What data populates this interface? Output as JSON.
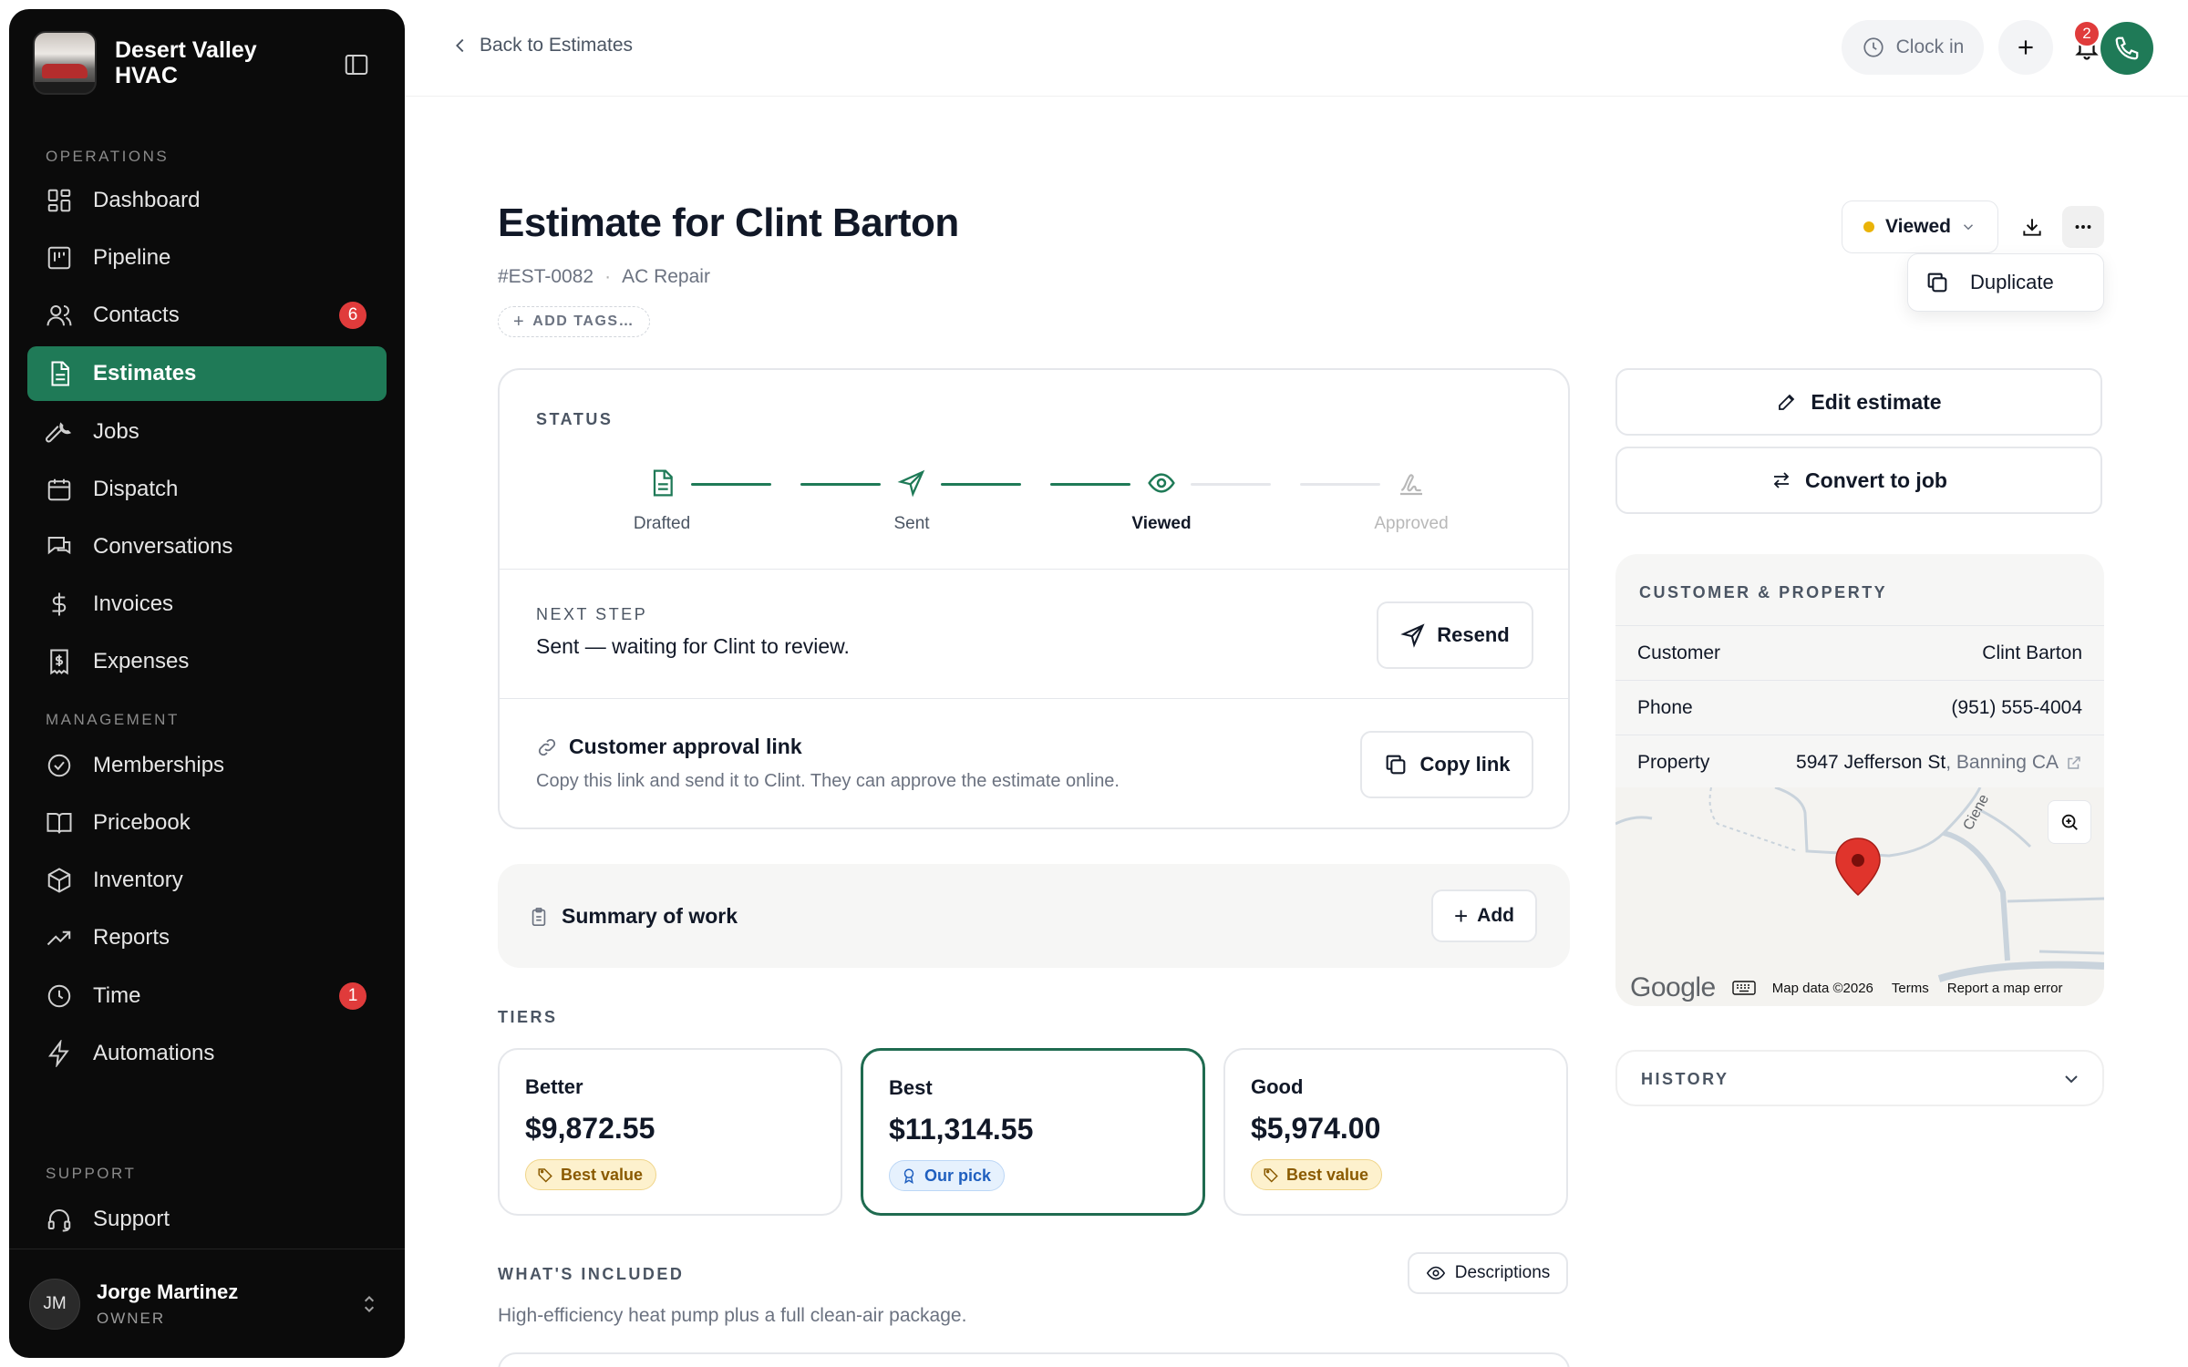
{
  "brand": {
    "name": "Desert Valley HVAC"
  },
  "sidebar": {
    "sections": [
      "OPERATIONS",
      "MANAGEMENT",
      "SUPPORT"
    ],
    "items": [
      {
        "label": "Dashboard",
        "icon": "dashboard-icon"
      },
      {
        "label": "Pipeline",
        "icon": "pipeline-icon"
      },
      {
        "label": "Contacts",
        "icon": "contacts-icon",
        "badge": "6"
      },
      {
        "label": "Estimates",
        "icon": "estimates-icon",
        "active": true
      },
      {
        "label": "Jobs",
        "icon": "wrench-icon"
      },
      {
        "label": "Dispatch",
        "icon": "calendar-icon"
      },
      {
        "label": "Conversations",
        "icon": "chat-icon"
      },
      {
        "label": "Invoices",
        "icon": "dollar-icon"
      },
      {
        "label": "Expenses",
        "icon": "receipt-icon"
      },
      {
        "label": "Memberships",
        "icon": "badge-check-icon"
      },
      {
        "label": "Pricebook",
        "icon": "book-icon"
      },
      {
        "label": "Inventory",
        "icon": "box-icon"
      },
      {
        "label": "Reports",
        "icon": "trend-icon"
      },
      {
        "label": "Time",
        "icon": "clock-icon",
        "badge": "1"
      },
      {
        "label": "Automations",
        "icon": "bolt-icon"
      },
      {
        "label": "Support",
        "icon": "headset-icon"
      }
    ],
    "user": {
      "initials": "JM",
      "name": "Jorge Martinez",
      "role": "OWNER"
    }
  },
  "topbar": {
    "back_label": "Back to Estimates",
    "clock_label": "Clock in",
    "notification_count": "2"
  },
  "estimate": {
    "title": "Estimate for Clint Barton",
    "number": "#EST-0082",
    "category": "AC Repair",
    "add_tags_label": "ADD TAGS…",
    "status_value": "Viewed",
    "status_color": "#eab308",
    "menu_item": "Duplicate"
  },
  "status_card": {
    "label": "STATUS",
    "steps": [
      {
        "label": "Drafted",
        "state": "done"
      },
      {
        "label": "Sent",
        "state": "done"
      },
      {
        "label": "Viewed",
        "state": "current"
      },
      {
        "label": "Approved",
        "state": "future"
      }
    ],
    "next_step_label": "NEXT STEP",
    "next_step_text": "Sent — waiting for Clint to review.",
    "resend_label": "Resend",
    "approval_title": "Customer approval link",
    "approval_desc": "Copy this link and send it to Clint. They can approve the estimate online.",
    "copy_link_label": "Copy link"
  },
  "summary": {
    "title": "Summary of work",
    "add_label": "Add"
  },
  "tiers": {
    "label": "TIERS",
    "items": [
      {
        "name": "Better",
        "price": "$9,872.55",
        "badge": "Best value",
        "selected": false
      },
      {
        "name": "Best",
        "price": "$11,314.55",
        "badge": "Our pick",
        "selected": true
      },
      {
        "name": "Good",
        "price": "$5,974.00",
        "badge": "Best value",
        "selected": false
      }
    ]
  },
  "included": {
    "label": "WHAT'S INCLUDED",
    "descriptions_label": "Descriptions",
    "text": "High-efficiency heat pump plus a full clean-air package."
  },
  "actions": {
    "edit_label": "Edit estimate",
    "convert_label": "Convert to job"
  },
  "customer": {
    "label": "CUSTOMER & PROPERTY",
    "rows": [
      {
        "key": "Customer",
        "value": "Clint Barton"
      },
      {
        "key": "Phone",
        "value": "(951) 555-4004"
      },
      {
        "key": "Property",
        "value": "5947 Jefferson St",
        "value_suffix": ", Banning CA"
      }
    ],
    "map": {
      "logo": "Google",
      "street_label": "Ciene",
      "map_data": "Map data ©2026",
      "terms": "Terms",
      "report": "Report a map error"
    }
  },
  "history": {
    "label": "HISTORY"
  },
  "colors": {
    "accent": "#1f7a57",
    "badge_red": "#e03b3b",
    "sidebar_bg": "#0b0b0b"
  }
}
